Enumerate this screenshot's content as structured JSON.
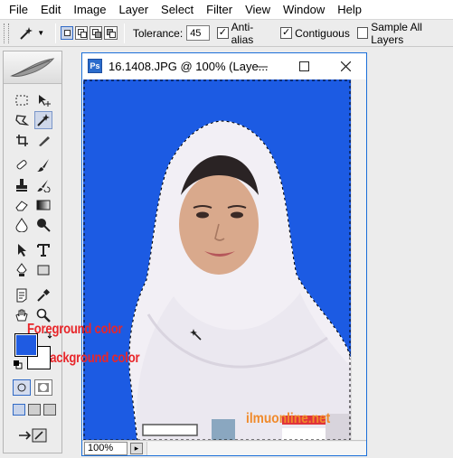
{
  "menu": [
    "File",
    "Edit",
    "Image",
    "Layer",
    "Select",
    "Filter",
    "View",
    "Window",
    "Help"
  ],
  "options": {
    "tolerance_label": "Tolerance:",
    "tolerance_value": "45",
    "antialias_label": "Anti-alias",
    "antialias_checked": true,
    "contiguous_label": "Contiguous",
    "contiguous_checked": true,
    "sample_all_label": "Sample All Layers",
    "sample_all_checked": false
  },
  "document": {
    "title": "16.1408.JPG @ 100% (Laye...",
    "zoom": "100%",
    "buttons": [
      "minimize",
      "maximize",
      "close"
    ]
  },
  "colors": {
    "foreground": "#1f5be2",
    "background": "#ffffff",
    "canvas_background": "#1c5be3",
    "selection_marquee": "#000000"
  },
  "annotations": {
    "foreground_label": "Foreground color",
    "background_label": "Background color"
  },
  "watermark": "ilmuonline.net",
  "icons": {
    "active_tool": "magic-wand-icon",
    "tools": [
      "rectangular-marquee-icon",
      "move-icon",
      "lasso-icon",
      "magic-wand-icon",
      "crop-icon",
      "slice-icon",
      "healing-brush-icon",
      "brush-icon",
      "clone-stamp-icon",
      "history-brush-icon",
      "eraser-icon",
      "gradient-icon",
      "blur-icon",
      "dodge-icon",
      "path-selection-icon",
      "type-icon",
      "pen-icon",
      "shape-icon",
      "notes-icon",
      "eyedropper-icon",
      "hand-icon",
      "zoom-icon"
    ]
  }
}
